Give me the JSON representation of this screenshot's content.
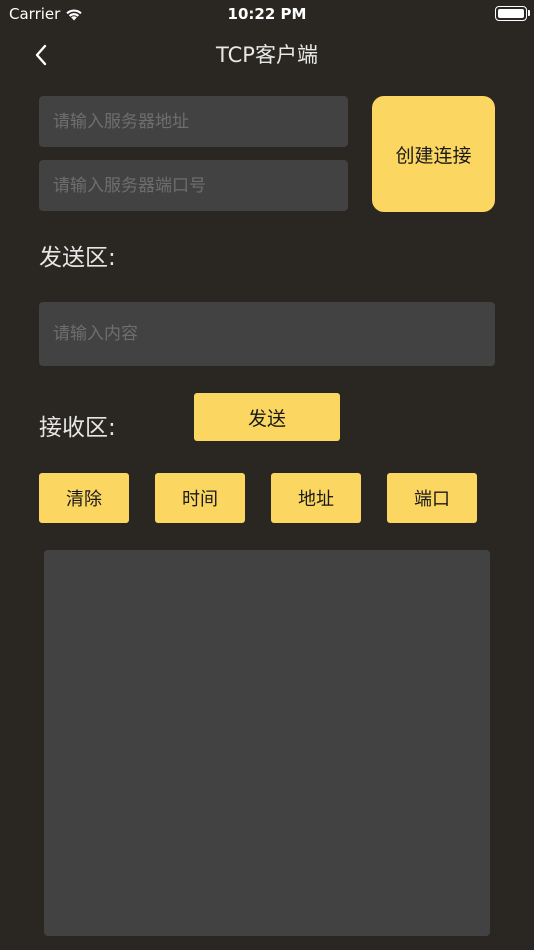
{
  "status_bar": {
    "carrier": "Carrier",
    "time": "10:22 PM"
  },
  "nav": {
    "title": "TCP客户端"
  },
  "connection": {
    "server_address_placeholder": "请输入服务器地址",
    "server_address_value": "",
    "server_port_placeholder": "请输入服务器端口号",
    "server_port_value": "",
    "connect_label": "创建连接"
  },
  "send": {
    "label": "发送区:",
    "content_placeholder": "请输入内容",
    "content_value": "",
    "send_label": "发送"
  },
  "receive": {
    "label": "接收区:",
    "options": [
      "清除",
      "时间",
      "地址",
      "端口"
    ],
    "content": ""
  },
  "colors": {
    "background": "#2a2621",
    "field": "#424242",
    "accent": "#fbd661",
    "placeholder": "#6e6e6e"
  }
}
